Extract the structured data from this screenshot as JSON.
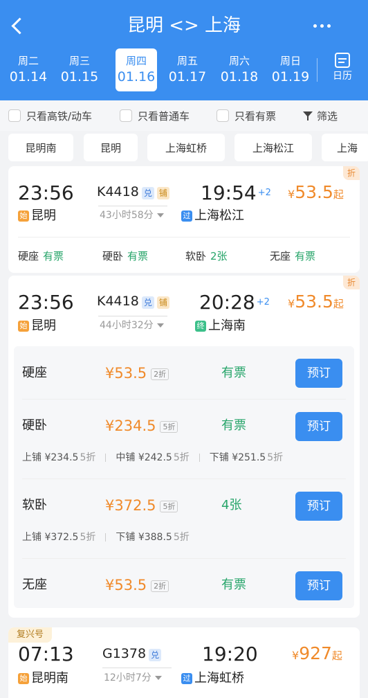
{
  "header": {
    "title": "昆明 <> 上海",
    "calendar_label": "日历"
  },
  "dates": [
    {
      "week": "周二",
      "date": "01.14",
      "selected": false
    },
    {
      "week": "周三",
      "date": "01.15",
      "selected": false
    },
    {
      "week": "周四",
      "date": "01.16",
      "selected": true
    },
    {
      "week": "周五",
      "date": "01.17",
      "selected": false
    },
    {
      "week": "周六",
      "date": "01.18",
      "selected": false
    },
    {
      "week": "周日",
      "date": "01.19",
      "selected": false
    }
  ],
  "filters": {
    "high_speed": "只看高铁/动车",
    "normal": "只看普通车",
    "has_ticket": "只看有票",
    "filter": "筛选"
  },
  "stations": [
    "昆明南",
    "昆明",
    "上海虹桥",
    "上海松江",
    "上海"
  ],
  "trains": [
    {
      "depart": "23:56",
      "number": "K4418",
      "tags": [
        "兑",
        "铺"
      ],
      "arrive": "19:54",
      "plus_days": "+2",
      "price_symbol": "¥",
      "price": "53.5",
      "price_suffix": "起",
      "discount_tag": "折",
      "from_badge": "始",
      "from": "昆明",
      "duration": "43小时58分",
      "to_badge": "过",
      "to": "上海松江",
      "seats": [
        {
          "name": "硬座",
          "status": "有票"
        },
        {
          "name": "硬卧",
          "status": "有票"
        },
        {
          "name": "软卧",
          "status": "2张"
        },
        {
          "name": "无座",
          "status": "有票"
        }
      ]
    },
    {
      "depart": "23:56",
      "number": "K4418",
      "tags": [
        "兑",
        "铺"
      ],
      "arrive": "20:28",
      "plus_days": "+2",
      "price_symbol": "¥",
      "price": "53.5",
      "price_suffix": "起",
      "discount_tag": "折",
      "from_badge": "始",
      "from": "昆明",
      "duration": "44小时32分",
      "to_badge": "终",
      "to": "上海南",
      "seat_details": [
        {
          "name": "硬座",
          "price": "¥53.5",
          "discount": "2折",
          "status": "有票",
          "button": "预订"
        },
        {
          "name": "硬卧",
          "price": "¥234.5",
          "discount": "5折",
          "status": "有票",
          "button": "预订",
          "berths": [
            {
              "label": "上铺",
              "price": "¥234.5",
              "discount": "5折"
            },
            {
              "label": "中铺",
              "price": "¥242.5",
              "discount": "5折"
            },
            {
              "label": "下铺",
              "price": "¥251.5",
              "discount": "5折"
            }
          ]
        },
        {
          "name": "软卧",
          "price": "¥372.5",
          "discount": "5折",
          "status": "4张",
          "button": "预订",
          "berths": [
            {
              "label": "上铺",
              "price": "¥372.5",
              "discount": "5折"
            },
            {
              "label": "下铺",
              "price": "¥388.5",
              "discount": "5折"
            }
          ]
        },
        {
          "name": "无座",
          "price": "¥53.5",
          "discount": "2折",
          "status": "有票",
          "button": "预订"
        }
      ]
    },
    {
      "label": "复兴号",
      "depart": "07:13",
      "number": "G1378",
      "tags": [
        "兑"
      ],
      "arrive": "19:20",
      "price_symbol": "¥",
      "price": "927",
      "price_suffix": "起",
      "from_badge": "始",
      "from": "昆明南",
      "duration": "12小时7分",
      "to_badge": "过",
      "to": "上海虹桥"
    }
  ]
}
